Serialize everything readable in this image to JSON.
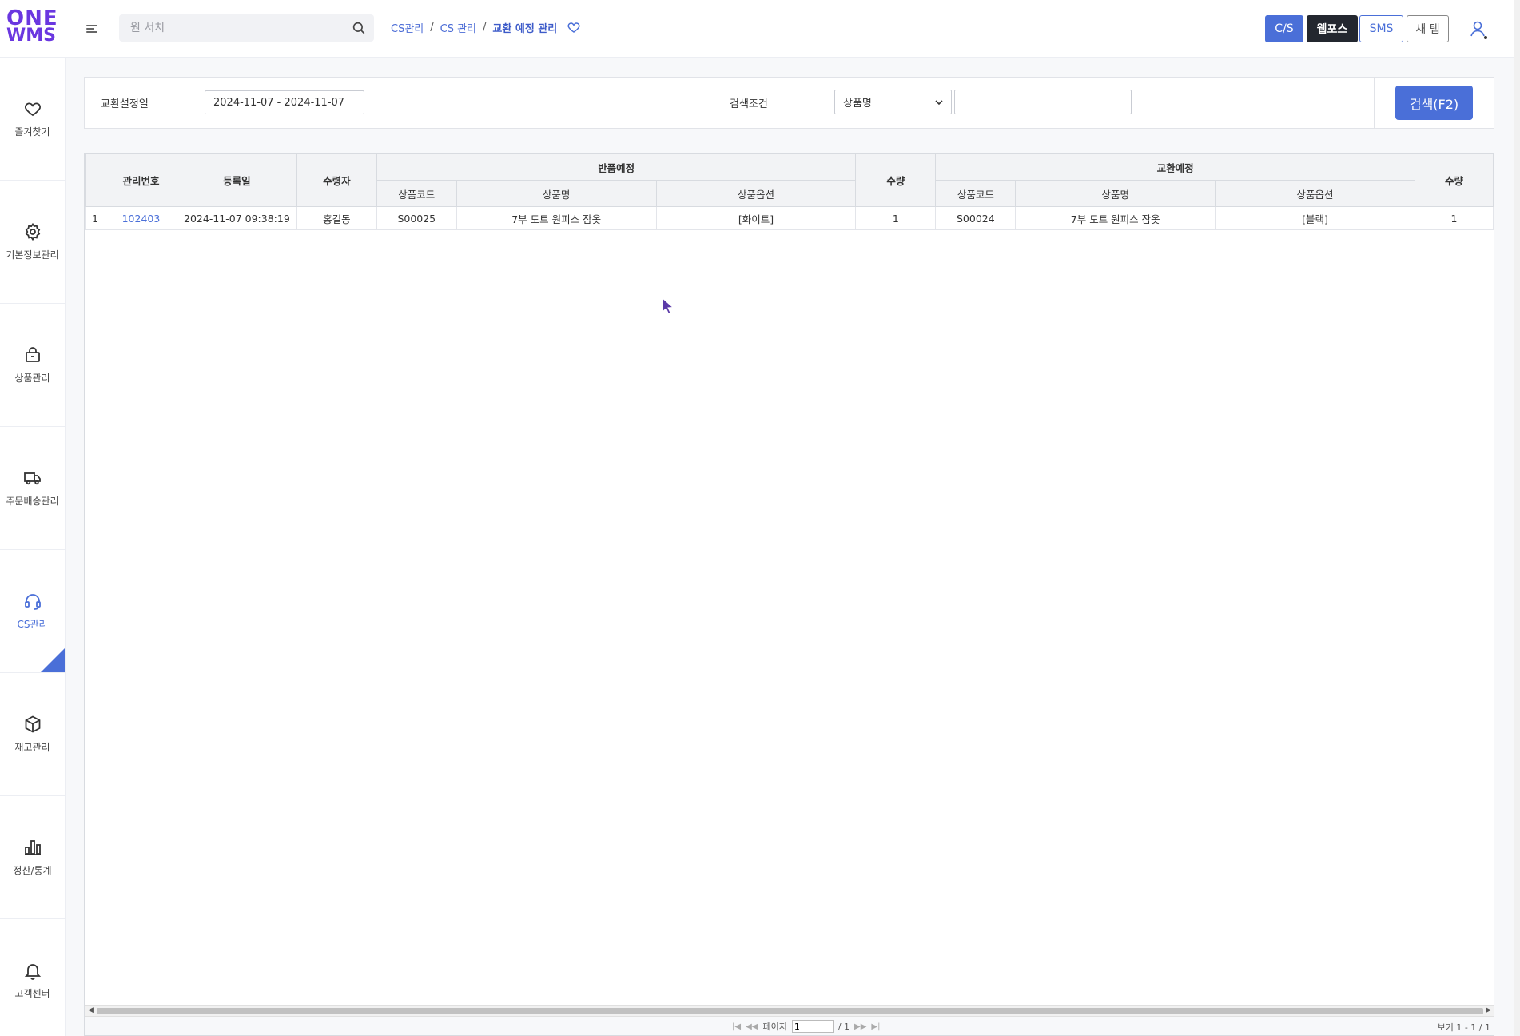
{
  "logo": {
    "line1": "ONE",
    "line2": "WMS"
  },
  "search": {
    "placeholder": "원 서치"
  },
  "breadcrumb": {
    "items": [
      "CS관리",
      "CS 관리"
    ],
    "current": "교환 예정 관리"
  },
  "top_buttons": {
    "cs": "C/S",
    "webpos": "웹포스",
    "sms": "SMS",
    "newtab": "새 탭"
  },
  "sidebar": {
    "items": [
      {
        "label": "즐겨찾기",
        "icon": "heart-icon"
      },
      {
        "label": "기본정보관리",
        "icon": "gear-icon"
      },
      {
        "label": "상품관리",
        "icon": "bag-icon"
      },
      {
        "label": "주문배송관리",
        "icon": "truck-icon"
      },
      {
        "label": "CS관리",
        "icon": "headset-icon",
        "active": true
      },
      {
        "label": "재고관리",
        "icon": "box-icon"
      },
      {
        "label": "정산/통계",
        "icon": "bar-chart-icon"
      },
      {
        "label": "고객센터",
        "icon": "bell-icon"
      }
    ]
  },
  "filter": {
    "date_label": "교환설정일",
    "date_value": "2024-11-07 - 2024-11-07",
    "condition_label": "검색조건",
    "condition_selected": "상품명",
    "search_button": "검색(F2)"
  },
  "grid": {
    "headers": {
      "mgmt_no": "관리번호",
      "reg_date": "등록일",
      "receiver": "수령자",
      "return_group": "반품예정",
      "exchange_group": "교환예정",
      "code": "상품코드",
      "name": "상품명",
      "option": "상품옵션",
      "qty": "수량"
    },
    "rows": [
      {
        "num": "1",
        "mgmt_no": "102403",
        "reg_date": "2024-11-07 09:38:19",
        "receiver": "홍길동",
        "ret_code": "S00025",
        "ret_name": "7부 도트 원피스 잠옷",
        "ret_option": "[화이트]",
        "ret_qty": "1",
        "ex_code": "S00024",
        "ex_name": "7부 도트 원피스 잠옷",
        "ex_option": "[블랙]",
        "ex_qty": "1"
      }
    ]
  },
  "pager": {
    "page_label": "페이지",
    "page_value": "1",
    "total": "/ 1",
    "view": "보기 1 - 1 / 1"
  },
  "colors": {
    "accent": "#4a6fd8",
    "brand": "#6a37e0",
    "dark": "#23272f"
  }
}
